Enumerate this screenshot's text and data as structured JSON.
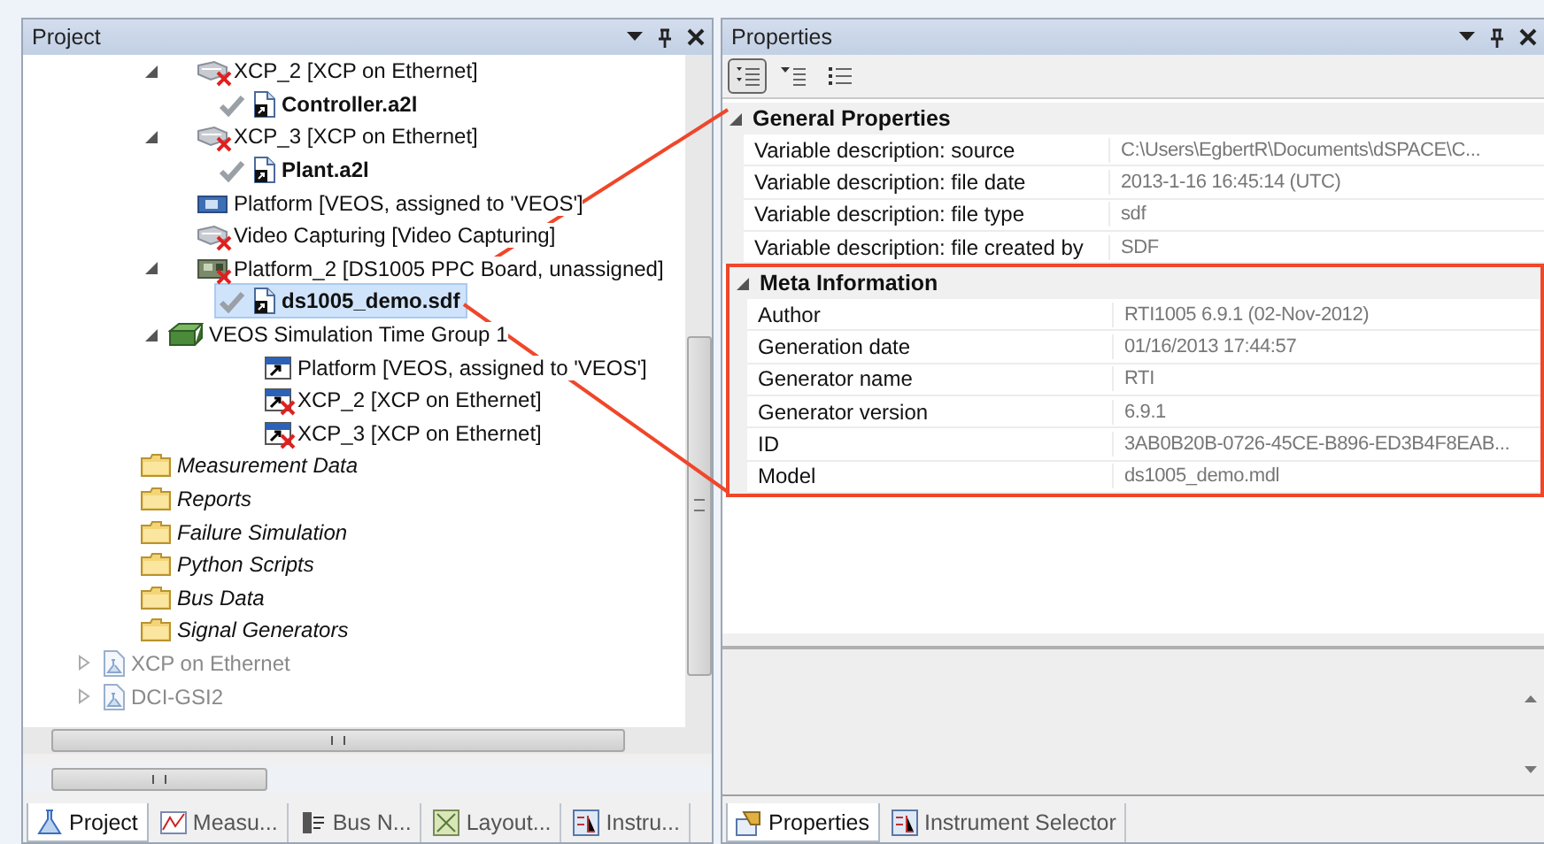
{
  "project_panel": {
    "title": "Project",
    "tree": [
      {
        "label": "XCP_2 [XCP on Ethernet]",
        "kind": "device",
        "expanded": true,
        "error": true,
        "selected": false,
        "children": [
          {
            "label": "Controller.a2l",
            "kind": "file",
            "error": false,
            "selected": false
          }
        ]
      },
      {
        "label": "XCP_3 [XCP on Ethernet]",
        "kind": "device",
        "expanded": true,
        "error": true,
        "selected": false,
        "children": [
          {
            "label": "Plant.a2l",
            "kind": "file",
            "error": false,
            "selected": false
          }
        ]
      },
      {
        "label": "Platform [VEOS, assigned to 'VEOS']",
        "kind": "platform",
        "error": false,
        "selected": false
      },
      {
        "label": "Video Capturing [Video Capturing]",
        "kind": "device",
        "error": true,
        "selected": false
      },
      {
        "label": "Platform_2 [DS1005 PPC Board, unassigned]",
        "kind": "board",
        "expanded": true,
        "error": true,
        "selected": false,
        "children": [
          {
            "label": "ds1005_demo.sdf",
            "kind": "file",
            "error": false,
            "selected": true
          }
        ]
      },
      {
        "label": "VEOS Simulation Time Group 1",
        "kind": "group",
        "expanded": true,
        "error": false,
        "selected": false,
        "children": [
          {
            "label": "Platform [VEOS, assigned to 'VEOS']",
            "kind": "link",
            "error": false,
            "selected": false
          },
          {
            "label": "XCP_2 [XCP on Ethernet]",
            "kind": "link",
            "error": true,
            "selected": false
          },
          {
            "label": "XCP_3 [XCP on Ethernet]",
            "kind": "link",
            "error": true,
            "selected": false
          }
        ]
      }
    ],
    "folders": [
      {
        "label": "Measurement Data"
      },
      {
        "label": "Reports"
      },
      {
        "label": "Failure Simulation"
      },
      {
        "label": "Python Scripts"
      },
      {
        "label": "Bus Data"
      },
      {
        "label": "Signal Generators"
      }
    ],
    "projects": [
      {
        "label": "XCP on Ethernet",
        "expanded": false
      },
      {
        "label": "DCI-GSI2",
        "expanded": false
      }
    ],
    "tabs": [
      {
        "label": "Project",
        "selected": true,
        "kind": "project"
      },
      {
        "label": "Measu...",
        "selected": false,
        "kind": "chart"
      },
      {
        "label": "Bus N...",
        "selected": false,
        "kind": "bus"
      },
      {
        "label": "Layout...",
        "selected": false,
        "kind": "layout"
      },
      {
        "label": "Instru...",
        "selected": false,
        "kind": "instrument"
      }
    ]
  },
  "properties_panel": {
    "title": "Properties",
    "toolbar": [
      {
        "kind": "categorized",
        "selected": true
      },
      {
        "kind": "collapse",
        "selected": false
      },
      {
        "kind": "list",
        "selected": false
      }
    ],
    "categories": [
      {
        "name": "General Properties",
        "expanded": true,
        "highlighted": false,
        "rows": [
          {
            "name": "Variable description: source",
            "value": "C:\\Users\\EgbertR\\Documents\\dSPACE\\C..."
          },
          {
            "name": "Variable description: file date",
            "value": "2013-1-16 16:45:14 (UTC)"
          },
          {
            "name": "Variable description: file type",
            "value": "sdf"
          },
          {
            "name": "Variable description: file created by",
            "value": "SDF"
          }
        ]
      },
      {
        "name": "Meta Information",
        "expanded": true,
        "highlighted": true,
        "rows": [
          {
            "name": "Author",
            "value": "RTI1005 6.9.1 (02-Nov-2012)"
          },
          {
            "name": "Generation date",
            "value": "01/16/2013 17:44:57"
          },
          {
            "name": "Generator name",
            "value": "RTI"
          },
          {
            "name": "Generator version",
            "value": "6.9.1"
          },
          {
            "name": "ID",
            "value": "3AB0B20B-0726-45CE-B896-ED3B4F8EAB..."
          },
          {
            "name": "Model",
            "value": "ds1005_demo.mdl"
          }
        ]
      }
    ],
    "tabs": [
      {
        "label": "Properties",
        "selected": true,
        "kind": "properties"
      },
      {
        "label": "Instrument Selector",
        "selected": false,
        "kind": "instrument"
      }
    ]
  }
}
